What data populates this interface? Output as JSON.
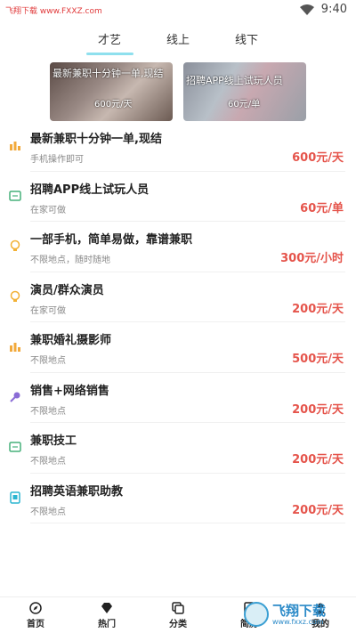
{
  "status_bar": {
    "watermark": "飞翔下载 www.FXXZ.com",
    "time": "9:40"
  },
  "tabs": [
    {
      "label": "才艺",
      "active": true
    },
    {
      "label": "线上",
      "active": false
    },
    {
      "label": "线下",
      "active": false
    }
  ],
  "banners": [
    {
      "text": "最新兼职十分钟一单,现结",
      "price": "600元/天"
    },
    {
      "text": "招聘APP线上试玩人员",
      "price": "60元/单"
    }
  ],
  "jobs": [
    {
      "title": "最新兼职十分钟一单,现结",
      "subtitle": "手机操作即可",
      "price": "600元/天",
      "icon": "bar-chart-icon",
      "icon_color": "#f2a93b"
    },
    {
      "title": "招聘APP线上试玩人员",
      "subtitle": "在家可做",
      "price": "60元/单",
      "icon": "screen-icon",
      "icon_color": "#46b07a"
    },
    {
      "title": "一部手机，简单易做，靠谱兼职",
      "subtitle": "不限地点，随时随地",
      "price": "300元/小时",
      "icon": "bulb-icon",
      "icon_color": "#f2b135"
    },
    {
      "title": "演员/群众演员",
      "subtitle": "在家可做",
      "price": "200元/天",
      "icon": "bulb-icon",
      "icon_color": "#f2b135"
    },
    {
      "title": "兼职婚礼摄影师",
      "subtitle": "不限地点",
      "price": "500元/天",
      "icon": "bar-chart-icon",
      "icon_color": "#f2a93b"
    },
    {
      "title": "销售+网络销售",
      "subtitle": "不限地点",
      "price": "200元/天",
      "icon": "mic-icon",
      "icon_color": "#8a6cd6"
    },
    {
      "title": "兼职技工",
      "subtitle": "不限地点",
      "price": "200元/天",
      "icon": "screen-icon",
      "icon_color": "#46b07a"
    },
    {
      "title": "招聘英语兼职助教",
      "subtitle": "不限地点",
      "price": "200元/天",
      "icon": "book-icon",
      "icon_color": "#2bb5d1"
    }
  ],
  "bottom_nav": [
    {
      "label": "首页",
      "icon": "compass-icon"
    },
    {
      "label": "热门",
      "icon": "diamond-icon"
    },
    {
      "label": "分类",
      "icon": "layers-icon"
    },
    {
      "label": "简历",
      "icon": "doc-icon"
    },
    {
      "label": "我的",
      "icon": "user-icon"
    }
  ],
  "watermark_logo": {
    "title": "飞翔下载",
    "url": "www.fxxz.com"
  }
}
